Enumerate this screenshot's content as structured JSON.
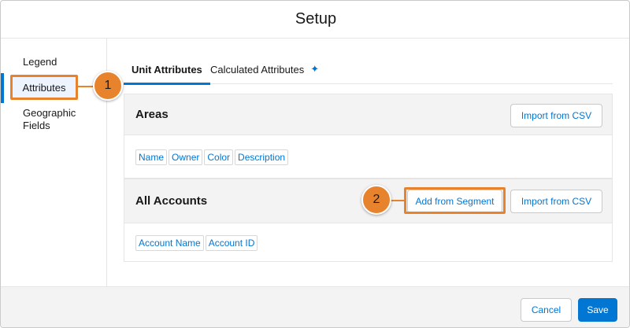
{
  "header": {
    "title": "Setup"
  },
  "sidebar": {
    "items": [
      {
        "label": "Legend"
      },
      {
        "label": "Attributes"
      },
      {
        "label_line1": "Geographic",
        "label_line2": "Fields"
      }
    ]
  },
  "tabs": [
    {
      "label": "Unit Attributes"
    },
    {
      "label": "Calculated Attributes",
      "icon": "sparkle-icon"
    }
  ],
  "sections": [
    {
      "title": "Areas",
      "buttons": [
        "Import from CSV"
      ],
      "fields": [
        "Name",
        "Owner",
        "Color",
        "Description"
      ]
    },
    {
      "title": "All Accounts",
      "buttons": [
        "Add from Segment",
        "Import from CSV"
      ],
      "fields": [
        "Account Name",
        "Account ID"
      ]
    }
  ],
  "callouts": [
    "1",
    "2"
  ],
  "footer": {
    "cancel": "Cancel",
    "save": "Save"
  },
  "colors": {
    "accent": "#0176d3",
    "callout": "#e8832d"
  }
}
